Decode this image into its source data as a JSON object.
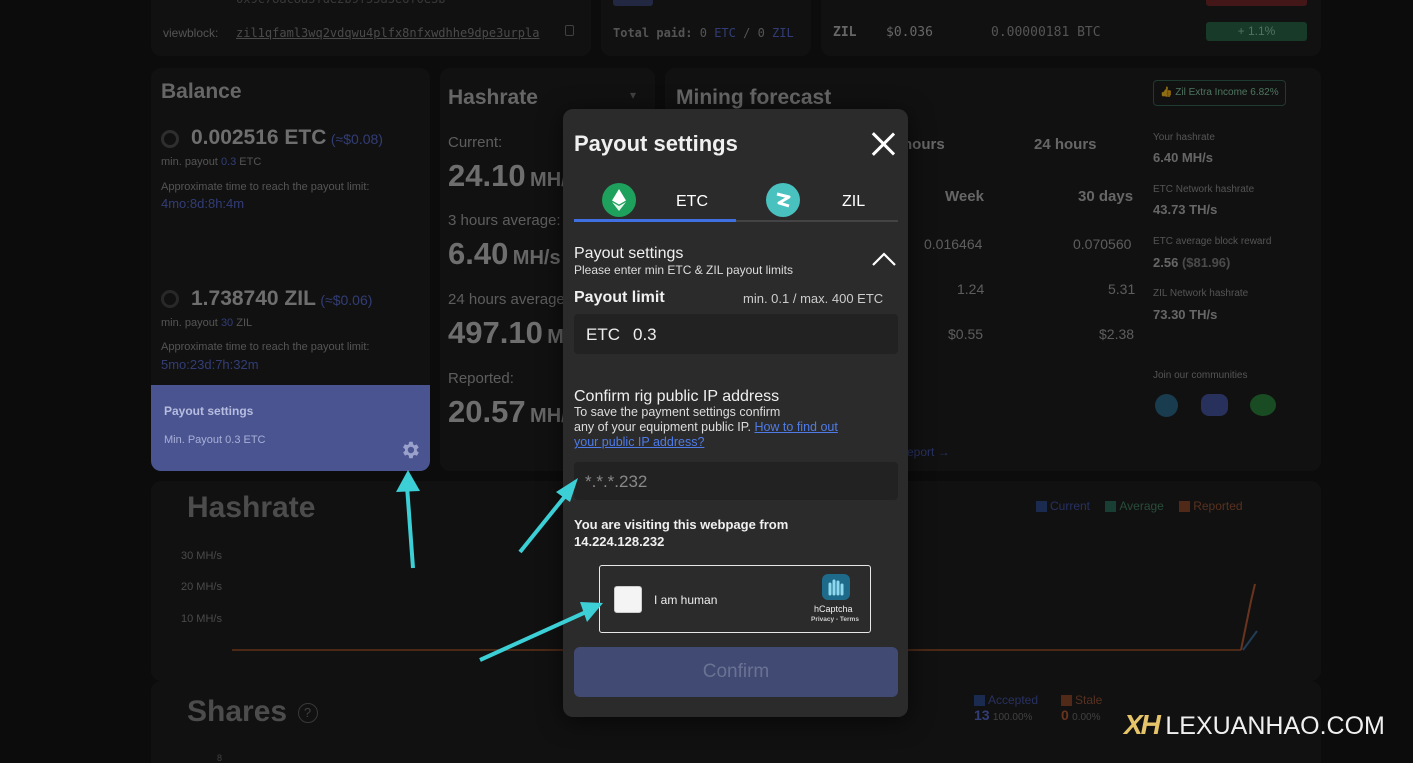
{
  "top": {
    "viewblock_label": "viewblock:",
    "viewblock_addr": "zil1qfaml3wq2vdqwu4plfx8nfxwdhhe9dpe3urpla",
    "total_paid_label": "Total paid:",
    "total_paid_etc": "0",
    "total_paid_etc_unit": "ETC",
    "total_paid_sep": "/",
    "total_paid_zil": "0",
    "total_paid_zil_unit": "ZIL",
    "zil_label": "ZIL",
    "zil_price": "$0.036",
    "zil_btc": "0.00000181 BTC",
    "zil_change": "+ 1.1%"
  },
  "balance": {
    "title": "Balance",
    "etc_amount": "0.002516 ETC",
    "etc_usd": "(≈$0.08)",
    "etc_min_label": "min. payout",
    "etc_min_value": "0.3",
    "etc_min_unit": "ETC",
    "approx_label": "Approximate time to reach the payout limit:",
    "etc_time": "4mo:8d:8h:4m",
    "zil_amount": "1.738740 ZIL",
    "zil_usd": "(≈$0.06)",
    "zil_min_label": "min. payout",
    "zil_min_value": "30",
    "zil_min_unit": "ZIL",
    "zil_time": "5mo:23d:7h:32m",
    "payout_settings": "Payout settings",
    "min_payout_text": "Min. Payout 0.3 ETC"
  },
  "hashrate_card": {
    "title": "Hashrate",
    "current_label": "Current:",
    "current_value": "24.10",
    "current_unit": "MH/s",
    "avg3_label": "3 hours average:",
    "avg3_value": "6.40",
    "avg3_unit": "MH/s",
    "avg24_label": "24 hours average:",
    "avg24_value": "497.10",
    "avg24_unit": "MH/s",
    "reported_label": "Reported:",
    "reported_value": "20.57",
    "reported_unit": "MH/s"
  },
  "forecast": {
    "title": "Mining forecast",
    "col_hours": "hours",
    "col_24h": "24 hours",
    "col_week": "Week",
    "col_30d": "30 days",
    "row1": [
      "0.016464",
      "0.070560"
    ],
    "row2": [
      "1.24",
      "5.31"
    ],
    "row3": [
      "$0.55",
      "$2.38"
    ],
    "report_link": "eport",
    "extra_income": "Zil Extra Income 6.82%",
    "your_hashrate_label": "Your hashrate",
    "your_hashrate": "6.40 MH/s",
    "etc_network_label": "ETC Network hashrate",
    "etc_network": "43.73 TH/s",
    "etc_reward_label": "ETC average block reward",
    "etc_reward": "2.56",
    "etc_reward_usd": "($81.96)",
    "zil_network_label": "ZIL Network hashrate",
    "zil_network": "73.30 TH/s",
    "communities": "Join our communities"
  },
  "chart": {
    "title": "Hashrate",
    "legend": [
      "Current",
      "Average",
      "Reported"
    ],
    "ticks": [
      "30 MH/s",
      "20 MH/s",
      "10 MH/s"
    ]
  },
  "shares": {
    "title": "Shares",
    "help": "?",
    "accepted_label": "Accepted",
    "accepted_value": "13",
    "accepted_pct": "100.00%",
    "stale_label": "Stale",
    "stale_value": "0",
    "stale_pct": "0.00%",
    "axis_tick": "8"
  },
  "watermark": {
    "logo": "XH",
    "site": "LEXUANHAO.COM"
  },
  "modal": {
    "title": "Payout settings",
    "tab_etc": "ETC",
    "tab_zil": "ZIL",
    "section_title": "Payout settings",
    "section_sub": "Please enter min ETC & ZIL payout limits",
    "limit_label": "Payout limit",
    "limit_range": "min. 0.1 / max. 400 ETC",
    "input_prefix": "ETC",
    "input_value": "0.3",
    "ip_title": "Confirm rig public IP address",
    "ip_desc1": "To save the payment settings confirm",
    "ip_desc2": "any of your equipment public IP.",
    "ip_link1": "How to find out",
    "ip_link2": "your public IP address?",
    "ip_placeholder": "*.*.*.232",
    "visiting_label": "You are visiting this webpage from",
    "visiting_ip": "14.224.128.232",
    "captcha_label": "I am human",
    "captcha_brand": "hCaptcha",
    "captcha_links": "Privacy - Terms",
    "confirm": "Confirm"
  },
  "colors": {
    "accent": "#3f6fe0",
    "eth_green": "#1ea15c",
    "zil_teal": "#49c1bf",
    "arrow": "#3ccfd6",
    "legend_current": "#3f6fe0",
    "legend_average": "#3aa887",
    "legend_reported": "#e06a3a"
  }
}
